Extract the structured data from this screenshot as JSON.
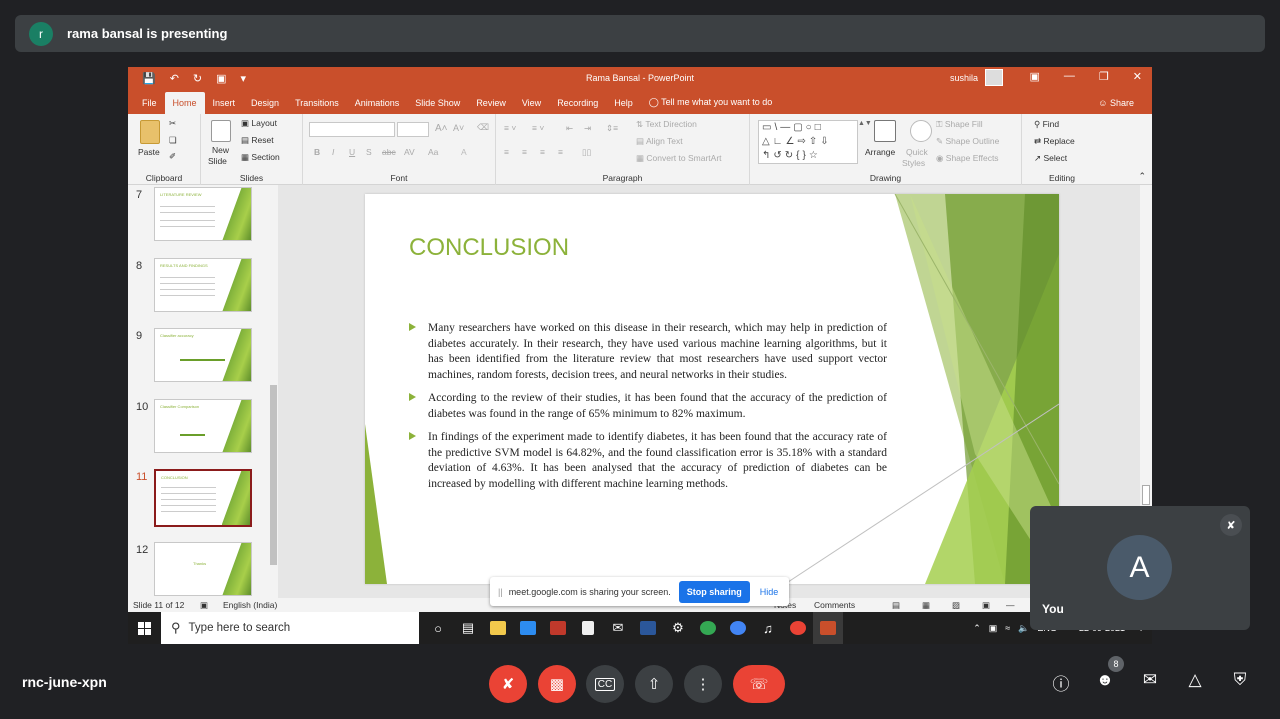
{
  "meet": {
    "presenter_initial": "r",
    "presenting_text": "rama bansal is presenting",
    "meeting_code": "rnc-june-xpn",
    "participant_count": "8",
    "self_tile": {
      "initial": "A",
      "name": "You"
    },
    "share_popup": {
      "grip": "||",
      "text": "meet.google.com is sharing your screen.",
      "stop": "Stop sharing",
      "hide": "Hide"
    }
  },
  "ppt": {
    "window_title": "Rama Bansal  -  PowerPoint",
    "user": "sushila",
    "tabs": [
      "File",
      "Home",
      "Insert",
      "Design",
      "Transitions",
      "Animations",
      "Slide Show",
      "Review",
      "View",
      "Recording",
      "Help"
    ],
    "tell_me": "Tell me what you want to do",
    "share": "Share",
    "ribbon": {
      "clipboard": {
        "label": "Clipboard",
        "paste": "Paste"
      },
      "slides": {
        "label": "Slides",
        "new_slide": "New",
        "new_slide2": "Slide",
        "layout": "Layout",
        "reset": "Reset",
        "section": "Section"
      },
      "font": {
        "label": "Font",
        "bold": "B",
        "italic": "I",
        "underline": "U",
        "shadow": "S",
        "strike": "abc",
        "spacing": "AV",
        "case": "Aa"
      },
      "paragraph": {
        "label": "Paragraph",
        "text_direction": "Text Direction",
        "align_text": "Align Text",
        "smartart": "Convert to SmartArt"
      },
      "drawing": {
        "label": "Drawing",
        "arrange": "Arrange",
        "quick": "Quick",
        "styles": "Styles",
        "fill": "Shape Fill",
        "outline": "Shape Outline",
        "effects": "Shape Effects"
      },
      "editing": {
        "label": "Editing",
        "find": "Find",
        "replace": "Replace",
        "select": "Select"
      }
    },
    "thumbnails": [
      {
        "num": "7",
        "title": "LITERATURE REVIEW"
      },
      {
        "num": "8",
        "title": "RESULTS AND FINDINGS"
      },
      {
        "num": "9",
        "title": "Classifier accuracy"
      },
      {
        "num": "10",
        "title": "Classifier Comparison"
      },
      {
        "num": "11",
        "title": "CONCLUSION"
      },
      {
        "num": "12",
        "title": "Thanks"
      }
    ],
    "slide": {
      "title": "CONCLUSION",
      "bullets": [
        "Many researchers have worked on this disease in their research, which may help in prediction of diabetes accurately. In their research, they have used various machine learning algorithms, but it has been identified from the literature review that most researchers have used support vector machines, random forests, decision trees, and neural networks in their studies.",
        "According to the review of their studies, it has been found that the accuracy of the prediction of diabetes was found in the range of 65% minimum to 82% maximum.",
        "In findings of the experiment made to identify diabetes, it has been found that the accuracy rate of the predictive SVM model is 64.82%, and the found classification error is 35.18% with a standard deviation of 4.63%. It has been analysed that the accuracy of prediction of diabetes can be increased by modelling with different machine learning methods."
      ]
    },
    "status": {
      "slide_of": "Slide 11 of 12",
      "language": "English (India)",
      "notes": "Notes",
      "comments": "Comments"
    }
  },
  "taskbar": {
    "search_placeholder": "Type here to search",
    "lang": "ENG",
    "date": "22-09-2021",
    "notif": "7"
  },
  "colors": {
    "ppt_accent": "#c94f2b",
    "slide_green": "#8cb23a",
    "meet_red": "#ea4335",
    "meet_bg": "#202124"
  }
}
